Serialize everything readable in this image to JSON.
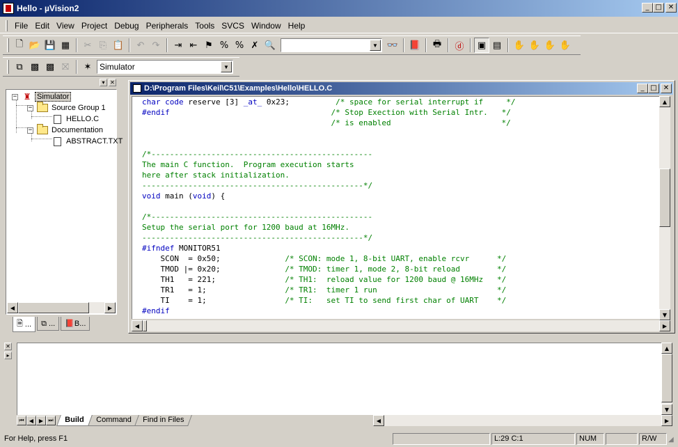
{
  "window": {
    "title": "Hello - µVision2"
  },
  "menu": [
    "File",
    "Edit",
    "View",
    "Project",
    "Debug",
    "Peripherals",
    "Tools",
    "SVCS",
    "Window",
    "Help"
  ],
  "menu_accel": [
    "F",
    "E",
    "V",
    "P",
    "D",
    "e",
    "T",
    "S",
    "W",
    "H"
  ],
  "toolbar": {
    "search_value": "",
    "target_value": "Simulator"
  },
  "project": {
    "tree": [
      {
        "label": "Simulator",
        "level": 0,
        "expanded": true,
        "selected": true,
        "kind": "target"
      },
      {
        "label": "Source Group 1",
        "level": 1,
        "expanded": true,
        "kind": "folder"
      },
      {
        "label": "HELLO.C",
        "level": 2,
        "kind": "file"
      },
      {
        "label": "Documentation",
        "level": 1,
        "expanded": true,
        "kind": "folder"
      },
      {
        "label": "ABSTRACT.TXT",
        "level": 2,
        "kind": "file"
      }
    ],
    "tabs": [
      "...",
      "...",
      "B..."
    ]
  },
  "editor": {
    "title": "D:\\Program Files\\Keil\\C51\\Examples\\Hello\\HELLO.C",
    "lines": [
      [
        [
          "kw",
          "char code"
        ],
        [
          "pl",
          " reserve [3] "
        ],
        [
          "kw",
          "_at_"
        ],
        [
          "pl",
          " 0x23;"
        ],
        [
          "cm",
          "          /* space for serial interrupt if     */"
        ]
      ],
      [
        [
          "kw",
          "#endif"
        ],
        [
          "cm",
          "                                   /* Stop Exection with Serial Intr.   */"
        ]
      ],
      [
        [
          "cm",
          "                                         /* is enabled                        */"
        ]
      ],
      [
        [
          "pl",
          ""
        ]
      ],
      [
        [
          "pl",
          ""
        ]
      ],
      [
        [
          "cm",
          "/*------------------------------------------------"
        ]
      ],
      [
        [
          "cm",
          "The main C function.  Program execution starts"
        ]
      ],
      [
        [
          "cm",
          "here after stack initialization."
        ]
      ],
      [
        [
          "cm",
          "------------------------------------------------*/"
        ]
      ],
      [
        [
          "kw",
          "void"
        ],
        [
          "pl",
          " main ("
        ],
        [
          "kw",
          "void"
        ],
        [
          "pl",
          ") {"
        ]
      ],
      [
        [
          "pl",
          ""
        ]
      ],
      [
        [
          "cm",
          "/*------------------------------------------------"
        ]
      ],
      [
        [
          "cm",
          "Setup the serial port for 1200 baud at 16MHz."
        ]
      ],
      [
        [
          "cm",
          "------------------------------------------------*/"
        ]
      ],
      [
        [
          "kw",
          "#ifndef"
        ],
        [
          "pl",
          " MONITOR51"
        ]
      ],
      [
        [
          "pl",
          "    SCON  = 0x50;              "
        ],
        [
          "cm",
          "/* SCON: mode 1, 8-bit UART, enable rcvr      */"
        ]
      ],
      [
        [
          "pl",
          "    TMOD |= 0x20;              "
        ],
        [
          "cm",
          "/* TMOD: timer 1, mode 2, 8-bit reload        */"
        ]
      ],
      [
        [
          "pl",
          "    TH1   = 221;               "
        ],
        [
          "cm",
          "/* TH1:  reload value for 1200 baud @ 16MHz   */"
        ]
      ],
      [
        [
          "pl",
          "    TR1   = 1;                 "
        ],
        [
          "cm",
          "/* TR1:  timer 1 run                          */"
        ]
      ],
      [
        [
          "pl",
          "    TI    = 1;                 "
        ],
        [
          "cm",
          "/* TI:   set TI to send first char of UART    */"
        ]
      ],
      [
        [
          "kw",
          "#endif"
        ]
      ]
    ]
  },
  "output": {
    "tabs": [
      "Build",
      "Command",
      "Find in Files"
    ],
    "active_tab": "Build"
  },
  "status": {
    "help": "For Help, press F1",
    "position": "L:29 C:1",
    "num": "NUM",
    "rw": "R/W"
  }
}
